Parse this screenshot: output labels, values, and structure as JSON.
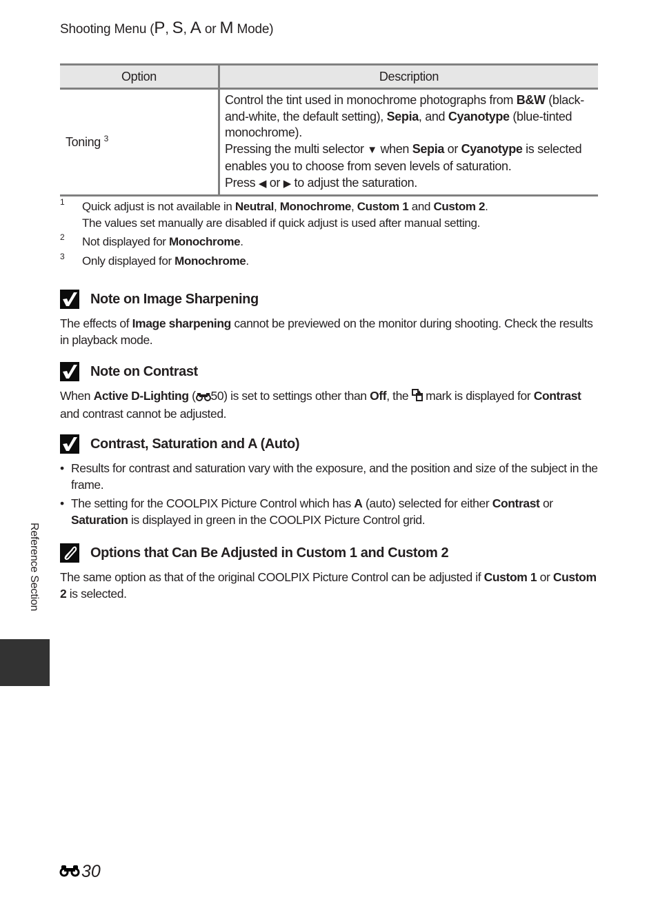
{
  "header": {
    "title_prefix": "Shooting Menu (",
    "mode_p": "P",
    "sep1": ", ",
    "mode_s": "S",
    "sep2": ", ",
    "mode_a": "A",
    "or": " or ",
    "mode_m": "M",
    "title_suffix": " Mode)"
  },
  "table": {
    "headers": [
      "Option",
      "Description"
    ],
    "rows": [
      {
        "option": "Toning",
        "option_sup": "3",
        "desc": {
          "p1a": "Control the tint used in monochrome photographs from ",
          "bw": "B&W",
          "p1b": " (black-and-white, the default setting), ",
          "sepia": "Sepia",
          "p1c": ", and ",
          "cyanotype": "Cyanotype",
          "p1d": " (blue-tinted monochrome).",
          "p2a": "Pressing the multi selector ",
          "down_icon": "▼",
          "p2b": " when ",
          "sepia2": "Sepia",
          "p2c": " or ",
          "cyanotype2": "Cyanotype",
          "p2d": " is selected enables you to choose from seven levels of saturation.",
          "p3a": "Press ",
          "left_icon": "◀",
          "p3b": " or ",
          "right_icon": "▶",
          "p3c": " to adjust the saturation."
        }
      }
    ]
  },
  "footnotes": [
    {
      "num": "1",
      "a": "Quick adjust is not available in ",
      "b1": "Neutral",
      "s1": ", ",
      "b2": "Monochrome",
      "s2": ", ",
      "b3": "Custom 1",
      "s3": " and ",
      "b4": "Custom 2",
      "s4": ".",
      "line2": "The values set manually are disabled if quick adjust is used after manual setting."
    },
    {
      "num": "2",
      "a": "Not displayed for ",
      "b1": "Monochrome",
      "s1": "."
    },
    {
      "num": "3",
      "a": "Only displayed for ",
      "b1": "Monochrome",
      "s1": "."
    }
  ],
  "sections": [
    {
      "icon": "checkmark-icon",
      "title": "Note on Image Sharpening",
      "a": "The effects of ",
      "b1": "Image sharpening",
      "c": " cannot be previewed on the monitor during shooting. Check the results in playback mode."
    },
    {
      "icon": "checkmark-icon",
      "title": "Note on Contrast",
      "a": "When ",
      "b1": "Active D-Lighting",
      "c": " (",
      "ref": "50",
      "d": ") is set to settings other than ",
      "b2": "Off",
      "e": ", the ",
      "f": " mark is displayed for ",
      "b3": "Contrast",
      "g": " and contrast cannot be adjusted."
    },
    {
      "icon": "checkmark-icon",
      "title": "Contrast, Saturation and A (Auto)",
      "bullets": [
        {
          "a": "Results for contrast and saturation vary with the exposure, and the position and size of the subject in the frame."
        },
        {
          "a": "The setting for the COOLPIX Picture Control which has ",
          "b1": "A",
          "c": " (auto) selected for either ",
          "b2": "Contrast",
          "d": " or ",
          "b3": "Saturation",
          "e": " is displayed in green in the COOLPIX Picture Control grid."
        }
      ]
    },
    {
      "icon": "pencil-clip-icon",
      "title": "Options that Can Be Adjusted in Custom 1 and Custom 2",
      "a": "The same option as that of the original COOLPIX Picture Control can be adjusted if ",
      "b1": "Custom 1",
      "c": " or ",
      "b2": "Custom 2",
      "d": " is selected."
    }
  ],
  "side_tab": {
    "label": "Reference Section"
  },
  "page_number": "30"
}
